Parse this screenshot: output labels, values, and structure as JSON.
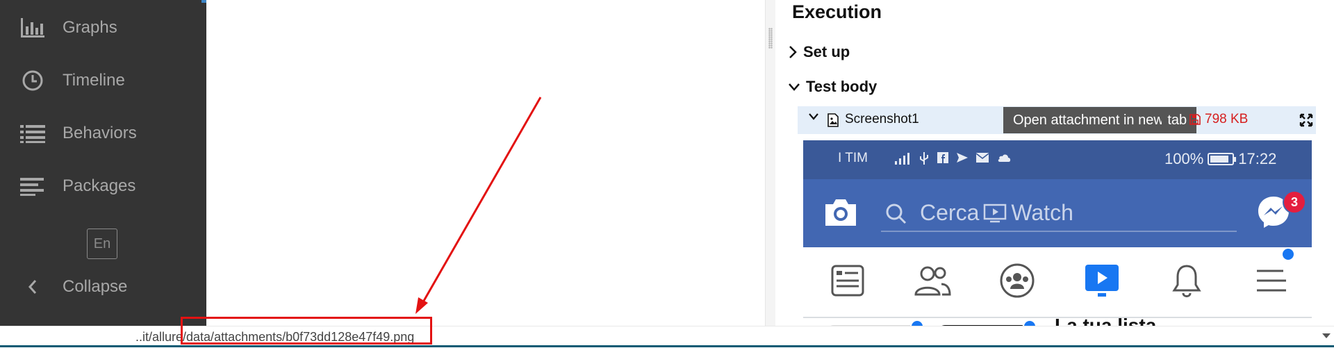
{
  "sidebar": {
    "items": [
      {
        "label": "Graphs",
        "icon": "bar-chart-icon"
      },
      {
        "label": "Timeline",
        "icon": "clock-icon"
      },
      {
        "label": "Behaviors",
        "icon": "list-icon"
      },
      {
        "label": "Packages",
        "icon": "align-left-icon"
      }
    ],
    "language": "En",
    "collapse_label": "Collapse"
  },
  "status_bar": {
    "url": "..it/allure/data/attachments/b0f73dd128e47f49.png"
  },
  "execution": {
    "title": "Execution",
    "sections": [
      {
        "label": "Set up",
        "expanded": false
      },
      {
        "label": "Test body",
        "expanded": true
      }
    ],
    "attachment": {
      "name": "Screenshot1",
      "tooltip": "Open attachment in new tab",
      "size": "798 KB"
    }
  },
  "phone_screenshot": {
    "carrier": "I TIM",
    "battery": "100%",
    "time": "17:22",
    "search_text": "Cerca",
    "watch_text": "Watch",
    "messenger_badge": "3",
    "story_title": "La tua lista dei"
  },
  "colors": {
    "sidebar_bg": "#343434",
    "facebook_blue": "#4267b2",
    "highlight_red": "#e31212",
    "size_red": "#d61f1f",
    "attachment_row_bg": "#e4eef9"
  }
}
